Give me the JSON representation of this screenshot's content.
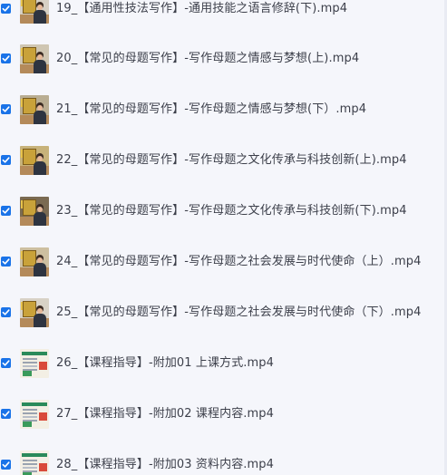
{
  "file_list": {
    "items": [
      {
        "checked": true,
        "thumb_style": "classroom",
        "name": "19_【通用性技法写作】-通用技能之语言修辞(下).mp4"
      },
      {
        "checked": true,
        "thumb_style": "classroom",
        "name": "20_【常见的母题写作】-写作母题之情感与梦想(上).mp4"
      },
      {
        "checked": true,
        "thumb_style": "classroom",
        "name": "21_【常见的母题写作】-写作母题之情感与梦想(下）.mp4"
      },
      {
        "checked": true,
        "thumb_style": "classroom",
        "name": "22_【常见的母题写作】-写作母题之文化传承与科技创新(上).mp4"
      },
      {
        "checked": true,
        "thumb_style": "classroom",
        "name": "23_【常见的母题写作】-写作母题之文化传承与科技创新(下).mp4"
      },
      {
        "checked": true,
        "thumb_style": "classroom",
        "name": "24_【常见的母题写作】-写作母题之社会发展与时代使命（上）.mp4"
      },
      {
        "checked": true,
        "thumb_style": "classroom",
        "name": "25_【常见的母题写作】-写作母题之社会发展与时代使命（下）.mp4"
      },
      {
        "checked": true,
        "thumb_style": "slide",
        "name": "26_【课程指导】-附加01 上课方式.mp4"
      },
      {
        "checked": true,
        "thumb_style": "slide",
        "name": "27_【课程指导】-附加02 课程内容.mp4"
      },
      {
        "checked": true,
        "thumb_style": "slide",
        "name": "28_【课程指导】-附加03 资料内容.mp4"
      }
    ]
  },
  "colors": {
    "background": "#f5f6fb",
    "checkbox": "#1a73e8",
    "text": "#3c3f4a"
  },
  "icons": {
    "checkbox": "checkmark-icon",
    "thumbnail": "video-thumbnail"
  }
}
